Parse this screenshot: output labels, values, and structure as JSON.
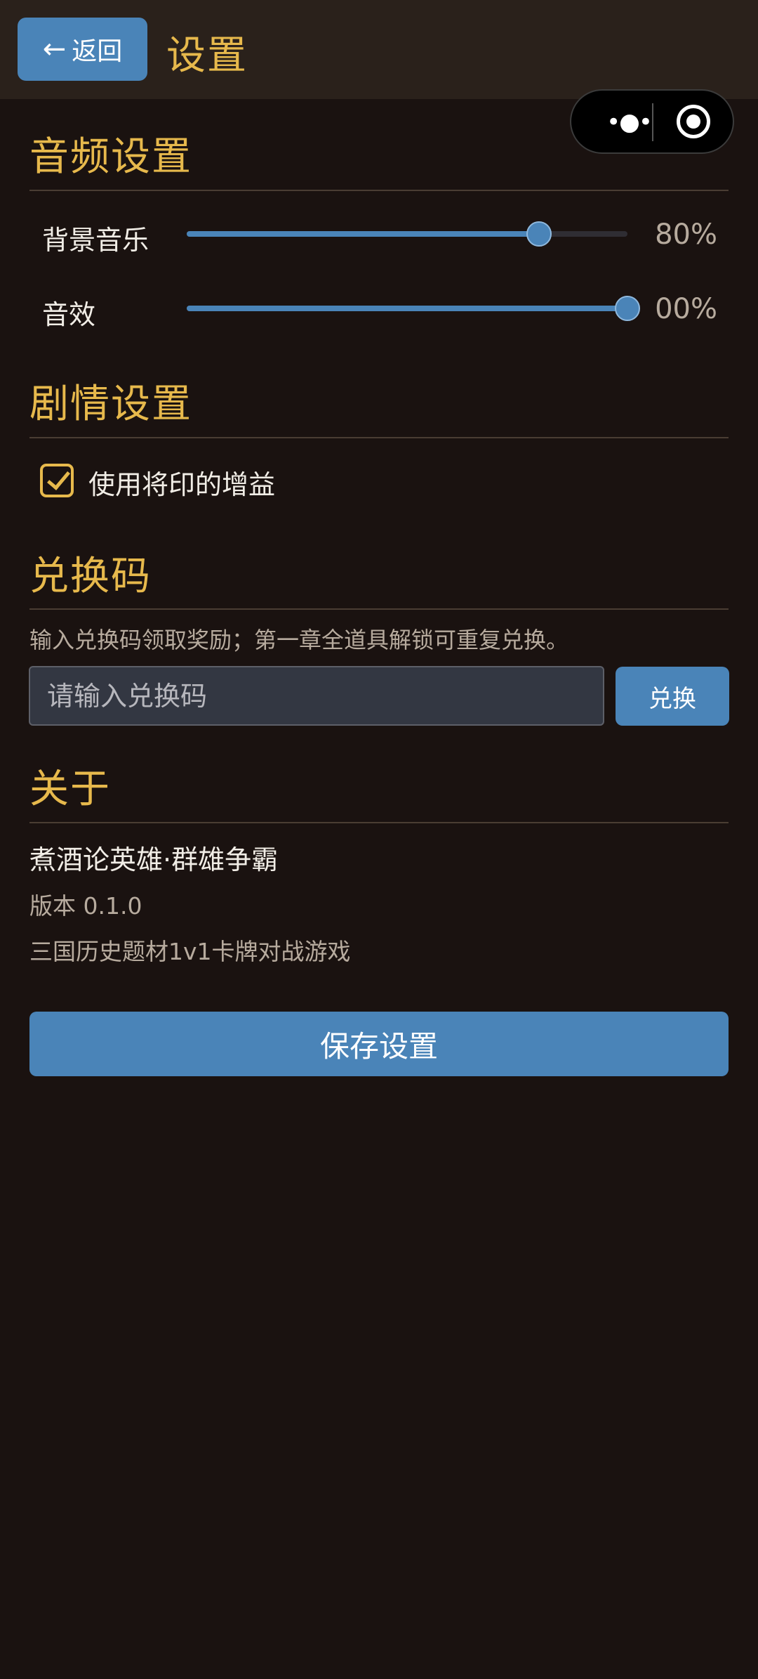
{
  "header": {
    "back_arrow": "←",
    "back_label": "返回",
    "title": "设置"
  },
  "capsule": {
    "more_icon": "more-dots-icon",
    "close_icon": "target-icon"
  },
  "audio": {
    "title": "音频设置",
    "bgm": {
      "label": "背景音乐",
      "value_text": "80%",
      "value": 0.8
    },
    "sfx": {
      "label": "音效",
      "value_text": "00%",
      "value": 1.0
    }
  },
  "story": {
    "title": "剧情设置",
    "seal_bonus": {
      "label": "使用将印的增益",
      "checked": true
    }
  },
  "redeem": {
    "title": "兑换码",
    "hint": "输入兑换码领取奖励；第一章全道具解锁可重复兑换。",
    "placeholder": "请输入兑换码",
    "value": "",
    "button_label": "兑换"
  },
  "about": {
    "title": "关于",
    "game_name": "煮酒论英雄·群雄争霸",
    "version": "版本 0.1.0",
    "description": "三国历史题材1v1卡牌对战游戏"
  },
  "save_label": "保存设置",
  "colors": {
    "background": "#1a1210",
    "accent_gold": "#e7b94c",
    "accent_blue": "#4a84b8"
  }
}
